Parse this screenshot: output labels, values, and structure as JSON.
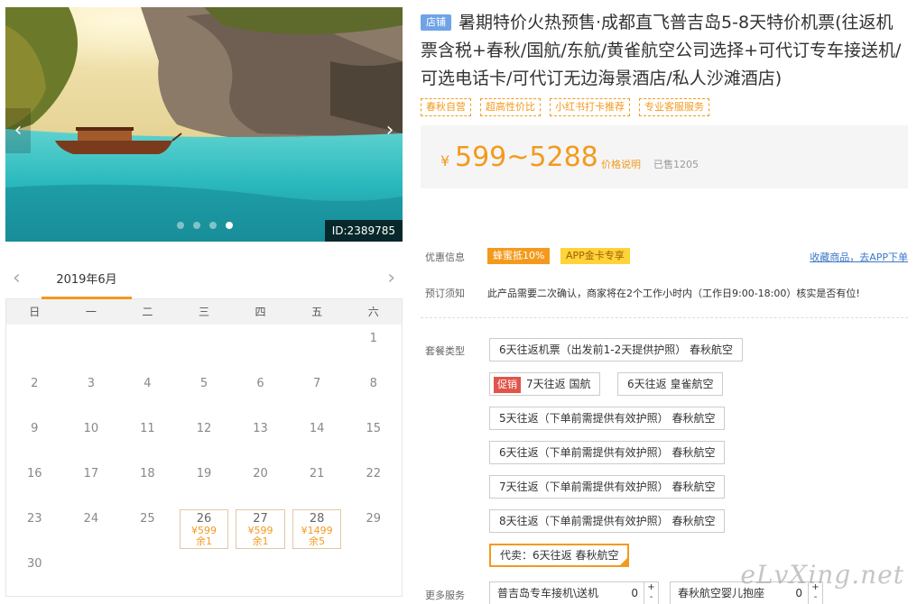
{
  "gallery": {
    "id_badge": "ID:2389785",
    "prev_arrow": "‹",
    "next_arrow": "›"
  },
  "calendar": {
    "month": "2019年6月",
    "prev": "‹",
    "next": "›",
    "weekdays": [
      "日",
      "一",
      "二",
      "三",
      "四",
      "五",
      "六"
    ],
    "days": [
      "1",
      "2",
      "3",
      "4",
      "5",
      "6",
      "7",
      "8",
      "9",
      "10",
      "11",
      "12",
      "13",
      "14",
      "15",
      "16",
      "17",
      "18",
      "19",
      "20",
      "21",
      "22",
      "23",
      "24",
      "25",
      "26",
      "27",
      "28",
      "29",
      "30"
    ],
    "available": [
      {
        "day": "26",
        "price": "¥599",
        "stock": "余1"
      },
      {
        "day": "27",
        "price": "¥599",
        "stock": "余1"
      },
      {
        "day": "28",
        "price": "¥1499",
        "stock": "余5"
      }
    ]
  },
  "product": {
    "shop_badge": "店铺",
    "title": "暑期特价火热预售·成都直飞普吉岛5-8天特价机票(往返机票含税+春秋/国航/东航/黄雀航空公司选择+可代订专车接送机/可选电话卡/可代订无边海景酒店/私人沙滩酒店)",
    "tags": [
      "春秋自营",
      "超高性价比",
      "小红书打卡推荐",
      "专业客服服务"
    ],
    "price_symbol": "¥",
    "price_range": "599~5288",
    "price_explain": "价格说明",
    "sold": "已售1205"
  },
  "discount": {
    "label": "优惠信息",
    "badges": [
      "蜂蜜抵10%",
      "APP金卡专享"
    ],
    "fav_link": "收藏商品，去APP下单"
  },
  "booking_notice": {
    "label": "预订须知",
    "text": "此产品需要二次确认，商家将在2个工作小时内（工作日9:00-18:00）核实是否有位!"
  },
  "packages": {
    "label": "套餐类型",
    "promo_badge": "促销",
    "items": [
      "6天往返机票（出发前1-2天提供护照） 春秋航空",
      "7天往返 国航",
      "6天往返 皇雀航空",
      "5天往返（下单前需提供有效护照） 春秋航空",
      "6天往返（下单前需提供有效护照） 春秋航空",
      "7天往返（下单前需提供有效护照） 春秋航空",
      "8天往返（下单前需提供有效护照） 春秋航空",
      "代卖：6天往返 春秋航空"
    ]
  },
  "services": {
    "label": "更多服务",
    "items": [
      {
        "name": "普吉岛专车接机\\送机",
        "qty": "0",
        "stepper": "+ -"
      },
      {
        "name": "春秋航空婴儿抱座",
        "qty": "0",
        "stepper": "+ -"
      }
    ]
  },
  "watermark": "eLvXing.net"
}
